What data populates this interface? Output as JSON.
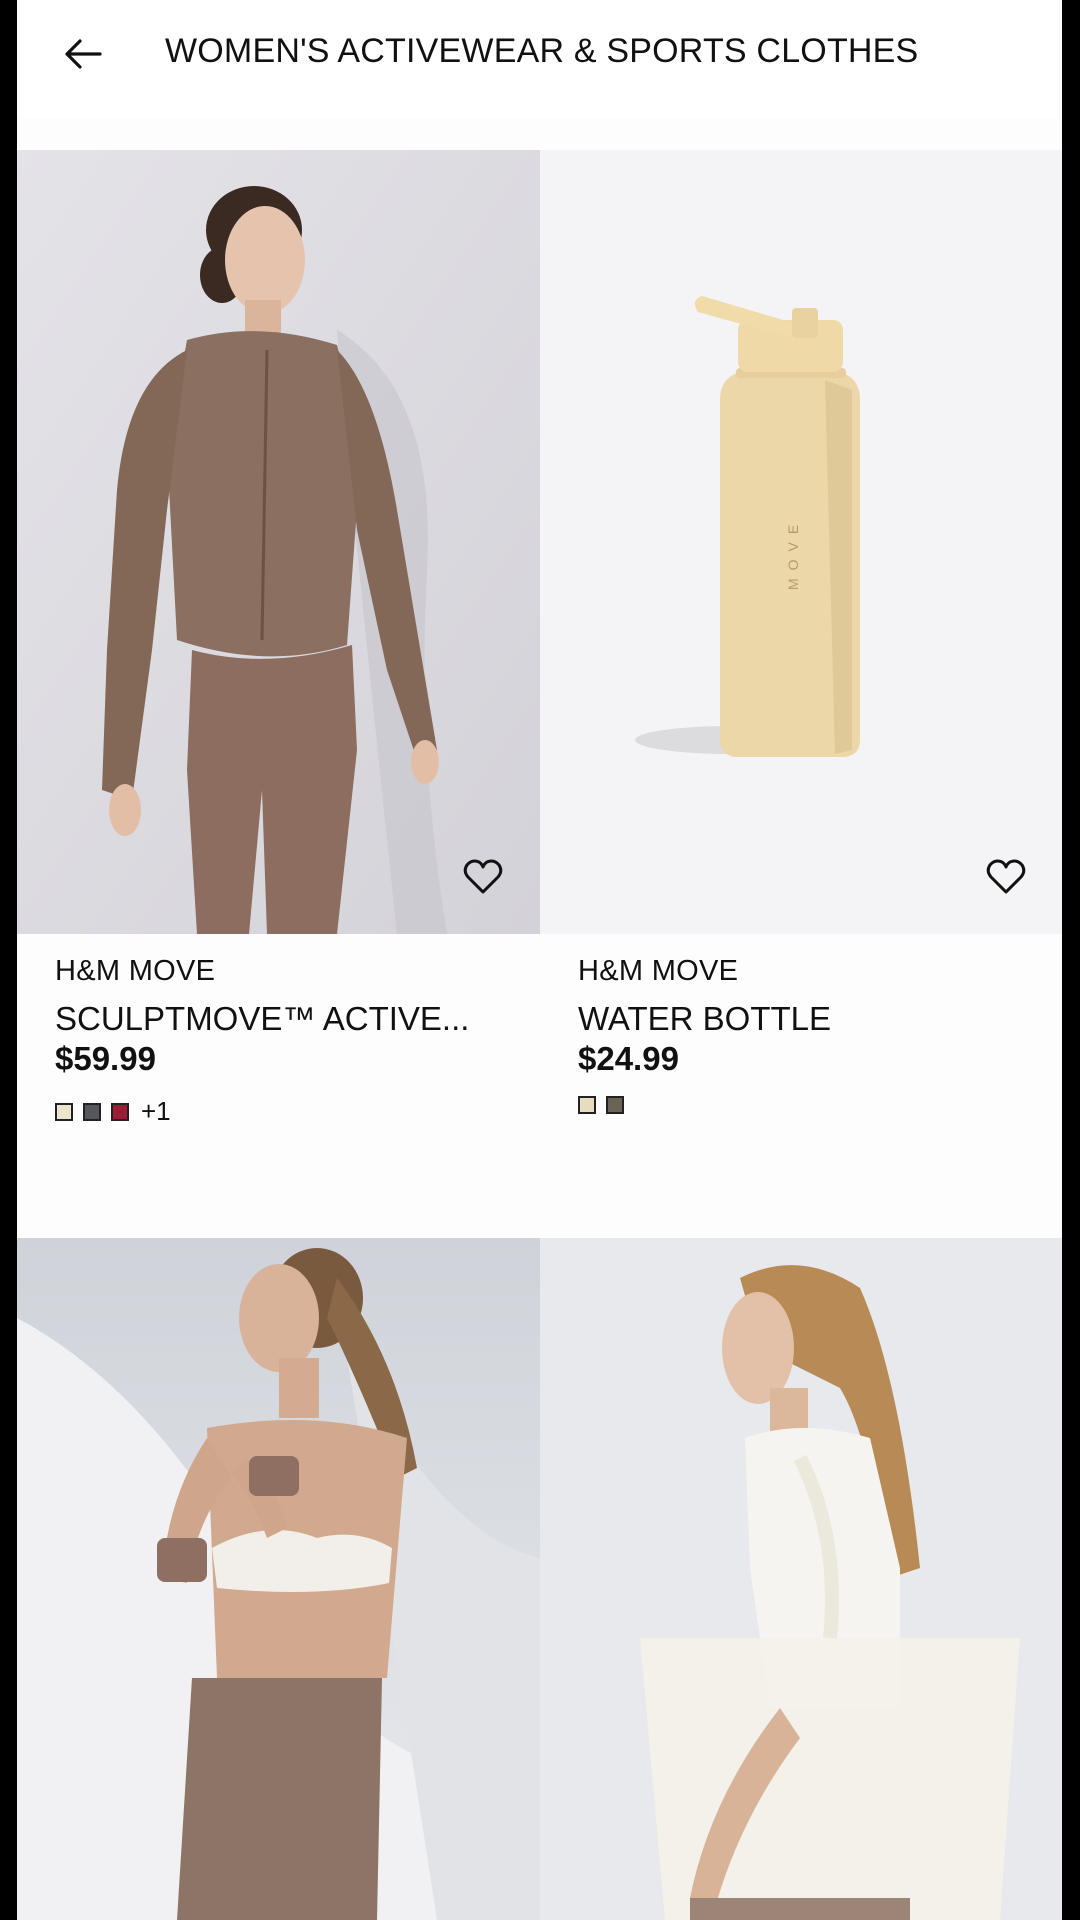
{
  "header": {
    "title": "WOMEN'S ACTIVEWEAR & SPORTS CLOTHES",
    "back_icon": "arrow-left-icon"
  },
  "products": [
    {
      "brand": "H&M MOVE",
      "name": "SCULPTMOVE™ ACTIVE...",
      "price": "$59.99",
      "swatches": [
        "#ece4cf",
        "#55575c",
        "#9c1b35"
      ],
      "more_colors": "+1",
      "favorite_icon": "heart-outline-icon",
      "image_desc": "model in brown zip jacket and leggings"
    },
    {
      "brand": "H&M MOVE",
      "name": "WATER BOTTLE",
      "price": "$24.99",
      "swatches": [
        "#e8dcc0",
        "#6b6358"
      ],
      "favorite_icon": "heart-outline-icon",
      "image_desc": "beige water bottle"
    },
    {
      "favorite_icon": "heart-outline-icon",
      "image_desc": "model in white sports bra and taupe leggings with wrist weights"
    },
    {
      "favorite_icon": "heart-outline-icon",
      "image_desc": "model in white t-shirt carrying white tote bag"
    }
  ],
  "colors": {
    "page_bg": "#fdfdfd",
    "frame_bg": "#000000",
    "text": "#111111"
  }
}
